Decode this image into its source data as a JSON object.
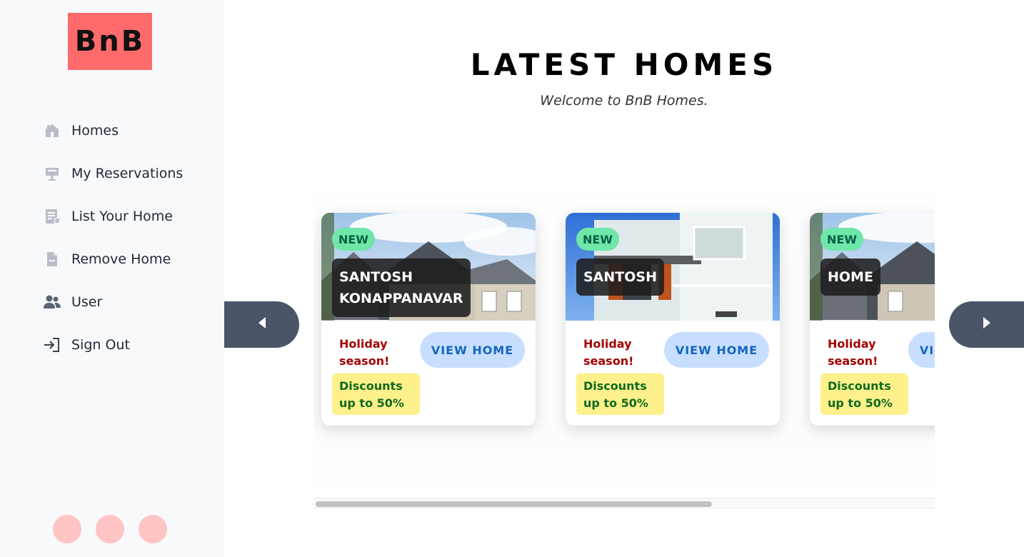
{
  "brand": {
    "logo_text": "BnB",
    "accent": "#ff6b6b"
  },
  "sidebar": {
    "items": [
      {
        "label": "Homes",
        "icon": "home-icon"
      },
      {
        "label": "My Reservations",
        "icon": "reservation-icon"
      },
      {
        "label": "List Your Home",
        "icon": "list-document-icon"
      },
      {
        "label": "Remove Home",
        "icon": "document-icon"
      },
      {
        "label": "User",
        "icon": "users-icon"
      },
      {
        "label": "Sign Out",
        "icon": "sign-out-icon"
      }
    ]
  },
  "main": {
    "title": "LATEST HOMES",
    "subtitle": "Welcome to BnB Homes."
  },
  "cards": [
    {
      "badge": "NEW",
      "name": "SANTOSH\nKONAPPANAVAR",
      "promo": "Holiday season!",
      "discount": "Discounts up to 50%",
      "button": "VIEW HOME"
    },
    {
      "badge": "NEW",
      "name": "SANTOSH",
      "promo": "Holiday season!",
      "discount": "Discounts up to 50%",
      "button": "VIEW HOME"
    },
    {
      "badge": "NEW",
      "name": "HOME",
      "promo": "Holiday season!",
      "discount": "Discounts up to 50%",
      "button": "VIEW HOME"
    }
  ],
  "colors": {
    "badge_new": "#6ee7a8",
    "promo_text": "#a30000",
    "discount_bg": "#fef08a",
    "view_button_bg": "#c7deff",
    "arrow_bg": "#4a5568"
  }
}
